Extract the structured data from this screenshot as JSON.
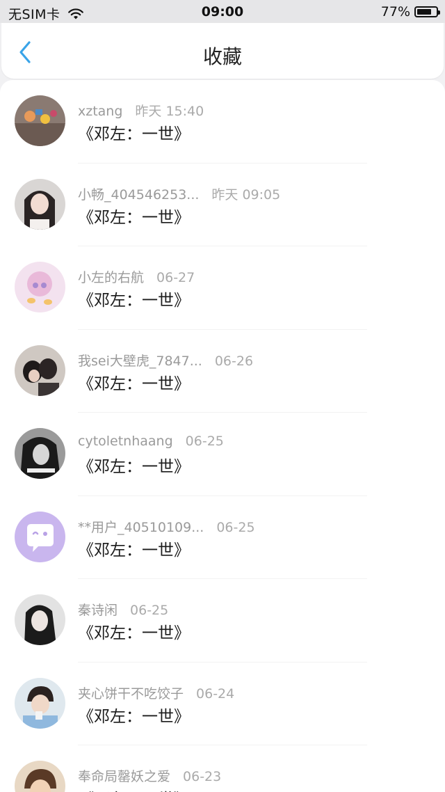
{
  "status_bar": {
    "carrier": "无SIM卡",
    "time": "09:00",
    "battery_text": "77%",
    "battery_level": 0.77
  },
  "nav": {
    "back_icon": "chevron-left-icon",
    "title": "收藏",
    "accent_color": "#3aa4e8"
  },
  "items": [
    {
      "name": "xztang",
      "time": "昨天 15:40",
      "title": "《邓左：一世》"
    },
    {
      "name": "小畅_404546253...",
      "time": "昨天 09:05",
      "title": "《邓左：一世》"
    },
    {
      "name": "小左的右航",
      "time": "06-27",
      "title": "《邓左：一世》"
    },
    {
      "name": "我sei大壁虎_7847...",
      "time": "06-26",
      "title": "《邓左：一世》"
    },
    {
      "name": "cytoletnhaang",
      "time": "06-25",
      "title": "《邓左：一世》"
    },
    {
      "name": "**用户_40510109...",
      "time": "06-25",
      "title": "《邓左：一世》"
    },
    {
      "name": "秦诗闲",
      "time": "06-25",
      "title": "《邓左：一世》"
    },
    {
      "name": "夹心饼干不吃饺子",
      "time": "06-24",
      "title": "《邓左：一世》"
    },
    {
      "name": "奉命局罄妖之爱",
      "time": "06-23",
      "title": "《邓左：一世》"
    }
  ]
}
